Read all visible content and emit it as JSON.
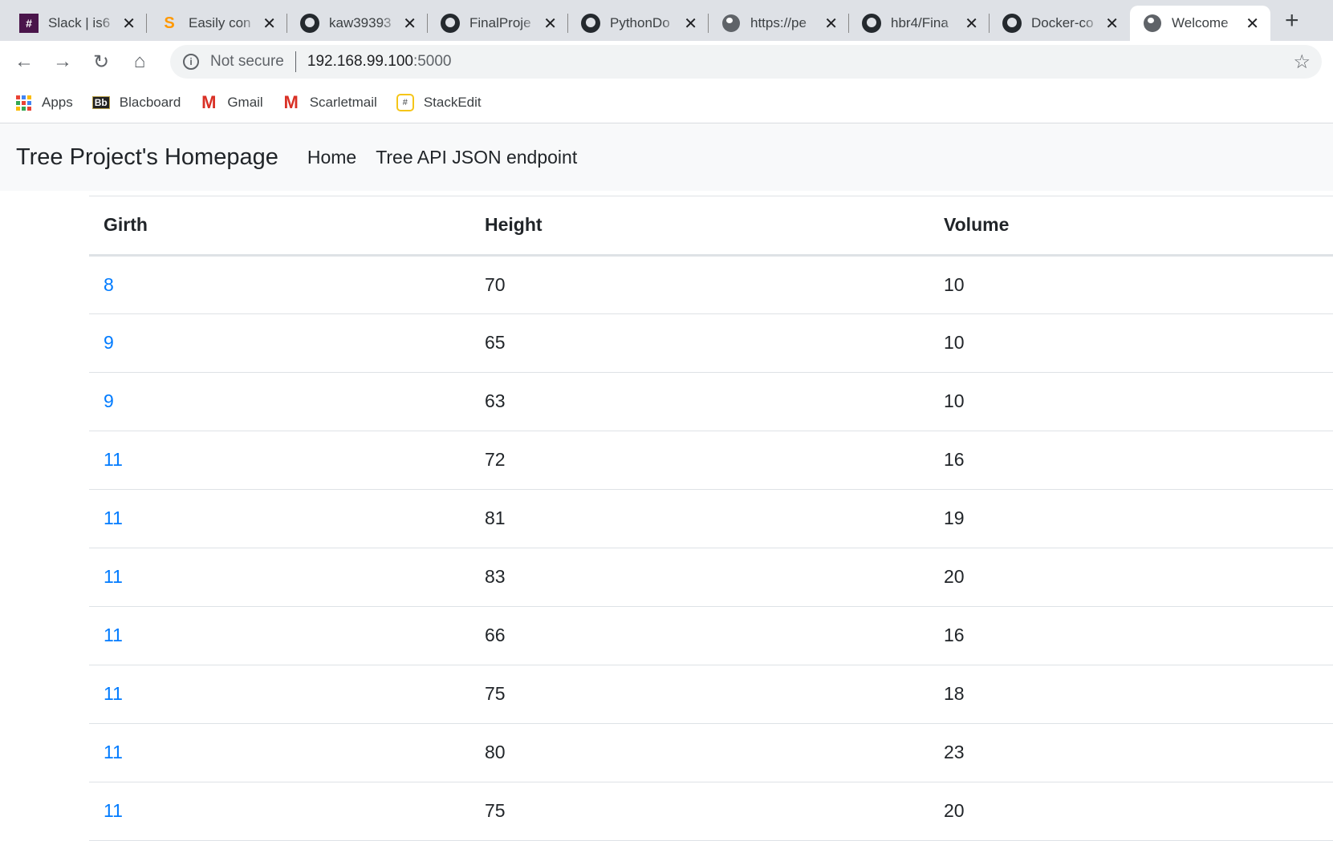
{
  "browser": {
    "tabs": [
      {
        "title": "Slack | is6",
        "icon": "slack-icon"
      },
      {
        "title": "Easily con",
        "icon": "sublime-icon"
      },
      {
        "title": "kaw39393",
        "icon": "github-icon"
      },
      {
        "title": "FinalProje",
        "icon": "github-icon"
      },
      {
        "title": "PythonDo",
        "icon": "github-icon"
      },
      {
        "title": "https://pe",
        "icon": "globe-icon"
      },
      {
        "title": "hbr4/Fina",
        "icon": "github-icon"
      },
      {
        "title": "Docker-co",
        "icon": "github-icon"
      },
      {
        "title": "Welcome",
        "icon": "globe-icon",
        "active": true
      }
    ],
    "security": "Not secure",
    "url_host": "192.168.99.100",
    "url_port": ":5000",
    "bookmarks": [
      "Apps",
      "Blacboard",
      "Gmail",
      "Scarletmail",
      "StackEdit"
    ]
  },
  "navbar": {
    "brand": "Tree Project's Homepage",
    "links": [
      "Home",
      "Tree API JSON endpoint"
    ]
  },
  "table": {
    "headers": [
      "Girth",
      "Height",
      "Volume"
    ],
    "rows": [
      [
        "8",
        "70",
        "10"
      ],
      [
        "9",
        "65",
        "10"
      ],
      [
        "9",
        "63",
        "10"
      ],
      [
        "11",
        "72",
        "16"
      ],
      [
        "11",
        "81",
        "19"
      ],
      [
        "11",
        "83",
        "20"
      ],
      [
        "11",
        "66",
        "16"
      ],
      [
        "11",
        "75",
        "18"
      ],
      [
        "11",
        "80",
        "23"
      ],
      [
        "11",
        "75",
        "20"
      ]
    ]
  }
}
